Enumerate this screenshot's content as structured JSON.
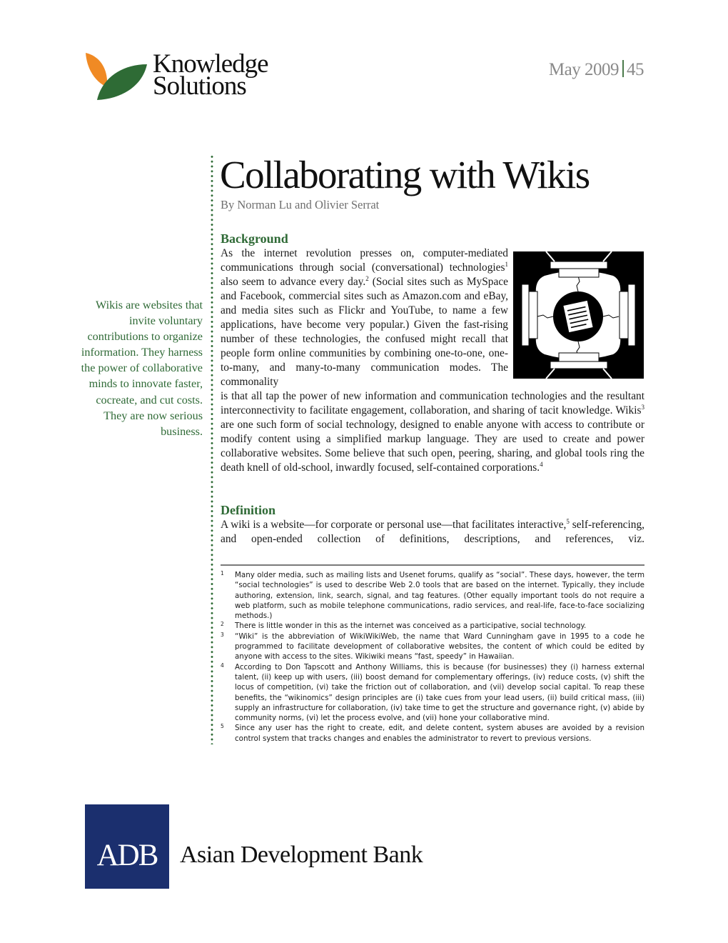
{
  "header": {
    "brand_line1": "Knowledge",
    "brand_line2": "Solutions",
    "issue_date": "May 2009",
    "page_number": "45",
    "leaf_colors": {
      "orange": "#f08a24",
      "green": "#2e6b35"
    }
  },
  "article": {
    "title": "Collaborating with Wikis",
    "byline": "By Norman Lu and Olivier Serrat"
  },
  "pullquote": "Wikis are websites that invite voluntary contributions to organize information. They harness the power of collaborative minds to innovate faster, cocreate, and cut costs. They are now serious business.",
  "sections": {
    "background": {
      "heading": "Background",
      "p1_a": "As the internet revolution presses on, computer-mediated communications through social (conversational) technologies",
      "p1_sup1": "1",
      "p1_b": " also seem to advance every day.",
      "p1_sup2": "2",
      "p1_c": " (Social sites such as MySpace and Facebook, commercial sites such as Amazon.com and eBay, and media sites such as Flickr and YouTube, to name a few applications, have become very popular.) Given the fast-rising number of these technologies, the confused might recall that people form online communities by combining one-to-one, one-to-many, and many-to-many communication modes. The commonality",
      "p2_a": "is that all tap the power of new information and communication technologies and the resultant interconnectivity to facilitate engagement, collaboration, and sharing of tacit knowledge. Wikis",
      "p2_sup3": "3",
      "p2_b": " are one such form of social technology, designed to enable anyone with access to contribute or modify content using a simplified markup language. They are used to create and power collaborative websites. Some believe that such open, peering, sharing, and global tools ring the death knell of old-school, inwardly focused, self-contained corporations.",
      "p2_sup4": "4"
    },
    "definition": {
      "heading": "Definition",
      "p_a": "A wiki is a website—for corporate or personal use—that facilitates interactive,",
      "p_sup5": "5",
      "p_b": " self-referencing, and open-ended collection of definitions, descriptions, and references, viz."
    }
  },
  "illustration": {
    "description": "four computers around a shared document"
  },
  "footnotes": [
    {
      "num": "1",
      "text": "Many older media, such as mailing lists and Usenet forums, qualify as “social”. These days, however, the term “social technologies” is used to describe Web 2.0 tools that are based on the internet. Typically, they include authoring, extension, link, search, signal, and tag features. (Other equally important tools do not require a web platform, such as mobile telephone communications, radio services, and real-life, face-to-face socializing methods.)"
    },
    {
      "num": "2",
      "text": "There is little wonder in this as the internet was conceived as a participative, social technology."
    },
    {
      "num": "3",
      "text": "“Wiki” is the abbreviation of WikiWikiWeb, the name that Ward Cunningham gave in 1995 to a code he programmed to facilitate development of collaborative websites, the content of which could be edited by anyone with access to the sites. Wikiwiki means “fast, speedy” in Hawaiian."
    },
    {
      "num": "4",
      "text": "According to Don Tapscott and Anthony Williams, this is because (for businesses) they (i) harness external talent, (ii) keep up with users, (iii) boost demand for complementary offerings, (iv) reduce costs, (v) shift the locus of competition, (vi) take the friction out of collaboration, and (vii) develop social capital. To reap these benefits, the “wikinomics” design principles are (i) take cues from your lead users, (ii) build critical mass, (iii) supply an infrastructure for collaboration, (iv) take time to get the structure and governance right, (v) abide by community norms, (vi) let the process evolve, and (vii) hone your collaborative mind."
    },
    {
      "num": "5",
      "text": "Since any user has the right to create, edit, and delete content, system abuses are avoided by a revision control system that tracks changes and enables the administrator to revert to previous versions."
    }
  ],
  "footer": {
    "adb_mark": "ADB",
    "adb_name": "Asian Development Bank",
    "adb_color": "#1b2f6e"
  }
}
